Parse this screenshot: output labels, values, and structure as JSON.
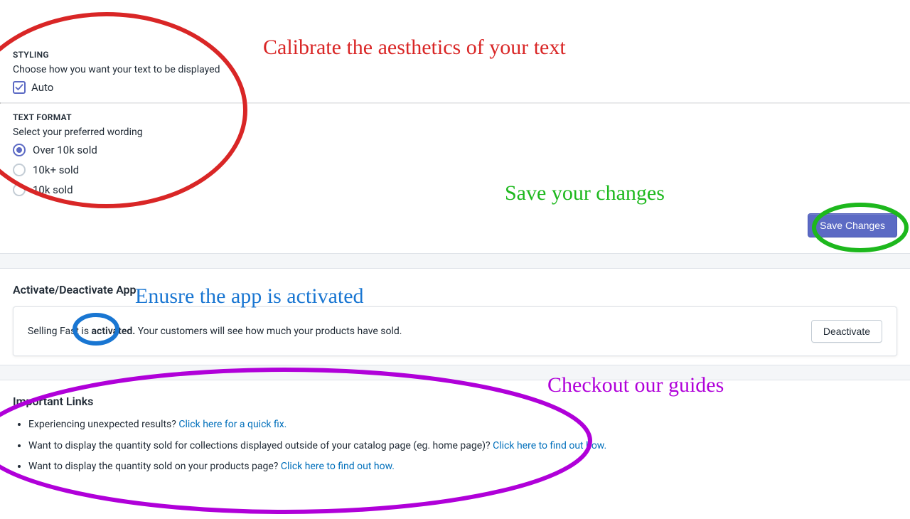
{
  "styling": {
    "title": "STYLING",
    "desc": "Choose how you want your text to be displayed",
    "checkbox_label": "Auto",
    "checked": true
  },
  "text_format": {
    "title": "TEXT FORMAT",
    "desc": "Select your preferred wording",
    "options": [
      "Over 10k sold",
      "10k+ sold",
      "10k sold"
    ],
    "selected_index": 0
  },
  "save_button": "Save Changes",
  "activate_section": {
    "heading": "Activate/Deactivate App",
    "status_prefix": "Selling Fast is ",
    "status_word": "activated.",
    "status_suffix": " Your customers will see how much your products have sold.",
    "button": "Deactivate"
  },
  "links_section": {
    "heading": "Important Links",
    "items": [
      {
        "text": "Experiencing unexpected results? ",
        "link": "Click here for a quick fix."
      },
      {
        "text": "Want to display the quantity sold for collections displayed outside of your catalog page (eg. home page)? ",
        "link": "Click here to find out how."
      },
      {
        "text": "Want to display the quantity sold on your products page? ",
        "link": "Click here to find out how."
      }
    ]
  },
  "annotations": {
    "calibrate": "Calibrate the aesthetics of your text",
    "save": "Save your changes",
    "activated": "Enusre the app is activated",
    "guides": "Checkout our guides"
  }
}
